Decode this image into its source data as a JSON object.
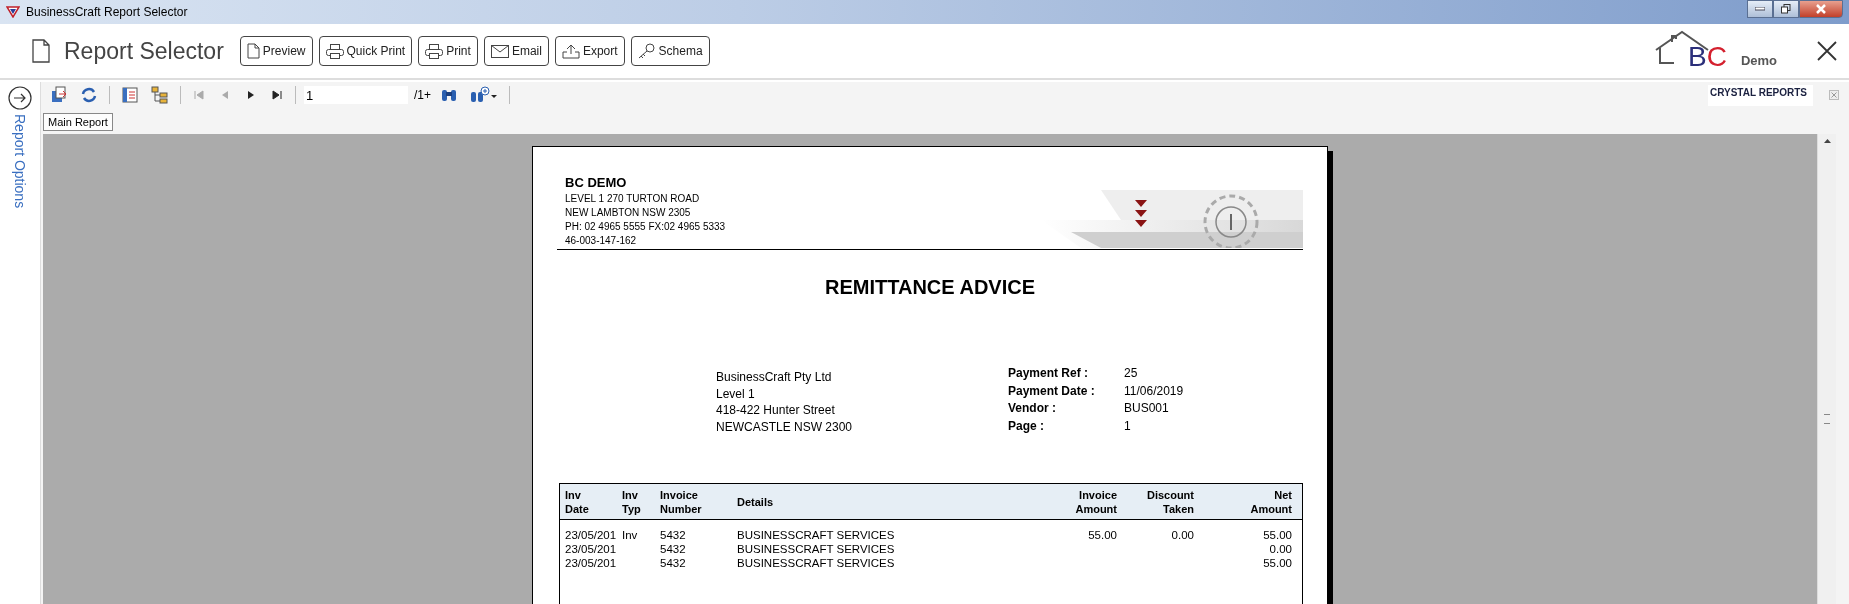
{
  "window": {
    "title": "BusinessCraft Report Selector"
  },
  "header": {
    "title": "Report Selector",
    "buttons": [
      {
        "label": "Preview",
        "kind": "document"
      },
      {
        "label": "Quick Print",
        "kind": "printer"
      },
      {
        "label": "Print",
        "kind": "printer"
      },
      {
        "label": "Email",
        "kind": "envelope"
      },
      {
        "label": "Export",
        "kind": "export"
      },
      {
        "label": "Schema",
        "kind": "key"
      }
    ],
    "logo_letters": [
      {
        "text": "B",
        "color": "#2b2f7a"
      },
      {
        "text": "C",
        "color": "#d4202e"
      }
    ],
    "logo_caption": "Demo"
  },
  "report_options": {
    "label": "Report Options"
  },
  "viewer_toolbar": {
    "page_input": "1",
    "page_count": "/1+",
    "brand": "CRYSTAL REPORTS"
  },
  "tabs": [
    {
      "label": "Main Report",
      "selected": true
    }
  ],
  "report": {
    "company": "BC DEMO",
    "company_lines": [
      "LEVEL 1 270 TURTON ROAD",
      "NEW LAMBTON NSW  2305",
      "PH: 02  4965 5555 FX:02 4965 5333",
      "46-003-147-162"
    ],
    "title": "REMITTANCE ADVICE",
    "remit_to": [
      "BusinessCraft Pty Ltd",
      "Level 1",
      "418-422 Hunter Street",
      "NEWCASTLE NSW 2300"
    ],
    "payment_info": [
      {
        "label": "Payment Ref :",
        "value": "25"
      },
      {
        "label": "Payment Date :",
        "value": "11/06/2019"
      },
      {
        "label": "Vendor :",
        "value": "BUS001"
      },
      {
        "label": "Page :",
        "value": "1"
      }
    ],
    "columns": [
      {
        "label": "Inv\nDate",
        "numeric": false
      },
      {
        "label": "Inv\nTyp",
        "numeric": false
      },
      {
        "label": "Invoice\nNumber",
        "numeric": false
      },
      {
        "label": "Details",
        "numeric": false
      },
      {
        "label": "Invoice\nAmount",
        "numeric": true
      },
      {
        "label": "Discount\nTaken",
        "numeric": true
      },
      {
        "label": "Net\nAmount",
        "numeric": true
      }
    ],
    "rows": [
      {
        "cells": [
          "23/05/201",
          "Inv",
          "5432",
          "BUSINESSCRAFT SERVICES",
          "55.00",
          "0.00",
          "55.00"
        ]
      },
      {
        "cells": [
          "23/05/201",
          null,
          "5432",
          "BUSINESSCRAFT SERVICES",
          null,
          null,
          "0.00"
        ]
      },
      {
        "cells": [
          "23/05/201",
          null,
          "5432",
          "BUSINESSCRAFT SERVICES",
          null,
          null,
          "55.00"
        ]
      }
    ]
  }
}
